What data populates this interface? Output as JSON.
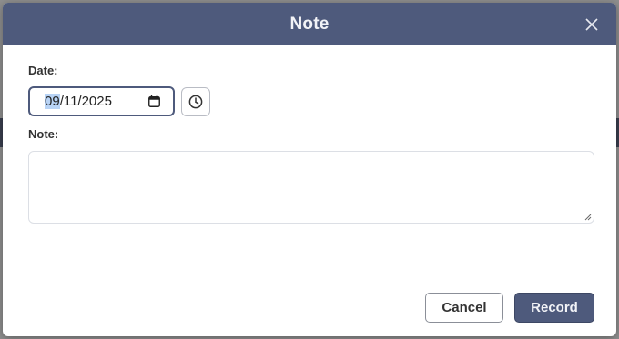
{
  "modal": {
    "title": "Note",
    "close_icon": "close-icon"
  },
  "date": {
    "label": "Date:",
    "month": "09",
    "rest": "/11/2025",
    "value": "09/11/2025",
    "calendar_icon": "calendar-icon",
    "clock_icon": "clock-icon"
  },
  "note": {
    "label": "Note:",
    "value": ""
  },
  "footer": {
    "cancel_label": "Cancel",
    "record_label": "Record"
  },
  "colors": {
    "header": "#4e5a7c",
    "primary_button": "#4e5a7c",
    "date_highlight": "#b8d3f5"
  }
}
